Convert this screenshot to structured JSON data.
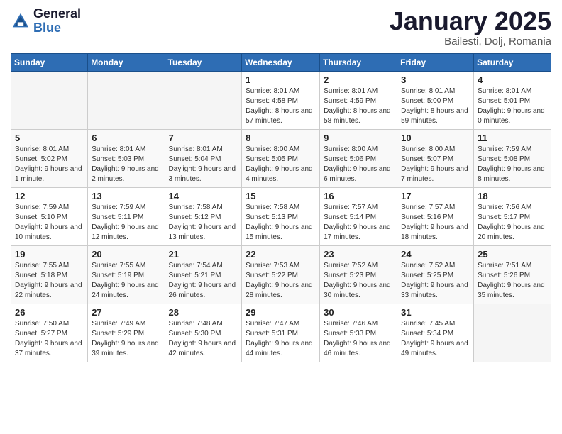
{
  "header": {
    "logo_general": "General",
    "logo_blue": "Blue",
    "month_title": "January 2025",
    "location": "Bailesti, Dolj, Romania"
  },
  "weekdays": [
    "Sunday",
    "Monday",
    "Tuesday",
    "Wednesday",
    "Thursday",
    "Friday",
    "Saturday"
  ],
  "weeks": [
    [
      {
        "day": "",
        "empty": true
      },
      {
        "day": "",
        "empty": true
      },
      {
        "day": "",
        "empty": true
      },
      {
        "day": "1",
        "sunrise": "8:01 AM",
        "sunset": "4:58 PM",
        "daylight": "8 hours and 57 minutes."
      },
      {
        "day": "2",
        "sunrise": "8:01 AM",
        "sunset": "4:59 PM",
        "daylight": "8 hours and 58 minutes."
      },
      {
        "day": "3",
        "sunrise": "8:01 AM",
        "sunset": "5:00 PM",
        "daylight": "8 hours and 59 minutes."
      },
      {
        "day": "4",
        "sunrise": "8:01 AM",
        "sunset": "5:01 PM",
        "daylight": "9 hours and 0 minutes."
      }
    ],
    [
      {
        "day": "5",
        "sunrise": "8:01 AM",
        "sunset": "5:02 PM",
        "daylight": "9 hours and 1 minute."
      },
      {
        "day": "6",
        "sunrise": "8:01 AM",
        "sunset": "5:03 PM",
        "daylight": "9 hours and 2 minutes."
      },
      {
        "day": "7",
        "sunrise": "8:01 AM",
        "sunset": "5:04 PM",
        "daylight": "9 hours and 3 minutes."
      },
      {
        "day": "8",
        "sunrise": "8:00 AM",
        "sunset": "5:05 PM",
        "daylight": "9 hours and 4 minutes."
      },
      {
        "day": "9",
        "sunrise": "8:00 AM",
        "sunset": "5:06 PM",
        "daylight": "9 hours and 6 minutes."
      },
      {
        "day": "10",
        "sunrise": "8:00 AM",
        "sunset": "5:07 PM",
        "daylight": "9 hours and 7 minutes."
      },
      {
        "day": "11",
        "sunrise": "7:59 AM",
        "sunset": "5:08 PM",
        "daylight": "9 hours and 8 minutes."
      }
    ],
    [
      {
        "day": "12",
        "sunrise": "7:59 AM",
        "sunset": "5:10 PM",
        "daylight": "9 hours and 10 minutes."
      },
      {
        "day": "13",
        "sunrise": "7:59 AM",
        "sunset": "5:11 PM",
        "daylight": "9 hours and 12 minutes."
      },
      {
        "day": "14",
        "sunrise": "7:58 AM",
        "sunset": "5:12 PM",
        "daylight": "9 hours and 13 minutes."
      },
      {
        "day": "15",
        "sunrise": "7:58 AM",
        "sunset": "5:13 PM",
        "daylight": "9 hours and 15 minutes."
      },
      {
        "day": "16",
        "sunrise": "7:57 AM",
        "sunset": "5:14 PM",
        "daylight": "9 hours and 17 minutes."
      },
      {
        "day": "17",
        "sunrise": "7:57 AM",
        "sunset": "5:16 PM",
        "daylight": "9 hours and 18 minutes."
      },
      {
        "day": "18",
        "sunrise": "7:56 AM",
        "sunset": "5:17 PM",
        "daylight": "9 hours and 20 minutes."
      }
    ],
    [
      {
        "day": "19",
        "sunrise": "7:55 AM",
        "sunset": "5:18 PM",
        "daylight": "9 hours and 22 minutes."
      },
      {
        "day": "20",
        "sunrise": "7:55 AM",
        "sunset": "5:19 PM",
        "daylight": "9 hours and 24 minutes."
      },
      {
        "day": "21",
        "sunrise": "7:54 AM",
        "sunset": "5:21 PM",
        "daylight": "9 hours and 26 minutes."
      },
      {
        "day": "22",
        "sunrise": "7:53 AM",
        "sunset": "5:22 PM",
        "daylight": "9 hours and 28 minutes."
      },
      {
        "day": "23",
        "sunrise": "7:52 AM",
        "sunset": "5:23 PM",
        "daylight": "9 hours and 30 minutes."
      },
      {
        "day": "24",
        "sunrise": "7:52 AM",
        "sunset": "5:25 PM",
        "daylight": "9 hours and 33 minutes."
      },
      {
        "day": "25",
        "sunrise": "7:51 AM",
        "sunset": "5:26 PM",
        "daylight": "9 hours and 35 minutes."
      }
    ],
    [
      {
        "day": "26",
        "sunrise": "7:50 AM",
        "sunset": "5:27 PM",
        "daylight": "9 hours and 37 minutes."
      },
      {
        "day": "27",
        "sunrise": "7:49 AM",
        "sunset": "5:29 PM",
        "daylight": "9 hours and 39 minutes."
      },
      {
        "day": "28",
        "sunrise": "7:48 AM",
        "sunset": "5:30 PM",
        "daylight": "9 hours and 42 minutes."
      },
      {
        "day": "29",
        "sunrise": "7:47 AM",
        "sunset": "5:31 PM",
        "daylight": "9 hours and 44 minutes."
      },
      {
        "day": "30",
        "sunrise": "7:46 AM",
        "sunset": "5:33 PM",
        "daylight": "9 hours and 46 minutes."
      },
      {
        "day": "31",
        "sunrise": "7:45 AM",
        "sunset": "5:34 PM",
        "daylight": "9 hours and 49 minutes."
      },
      {
        "day": "",
        "empty": true
      }
    ]
  ]
}
